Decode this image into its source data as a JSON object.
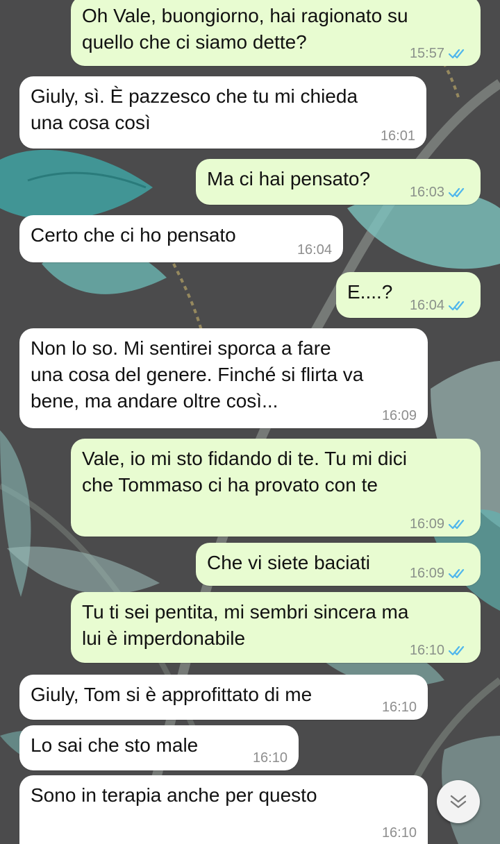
{
  "messages": [
    {
      "dir": "out",
      "text": "Oh Vale, buongiorno, hai ragionato su\nquello che ci siamo dette?",
      "time": "15:57",
      "read": true
    },
    {
      "dir": "in",
      "text": "Giuly, sì. È pazzesco che tu mi chieda\nuna cosa così",
      "time": "16:01"
    },
    {
      "dir": "out",
      "text": "Ma ci hai pensato?",
      "time": "16:03",
      "read": true
    },
    {
      "dir": "in",
      "text": "Certo che ci ho pensato",
      "time": "16:04"
    },
    {
      "dir": "out",
      "text": "E....?",
      "time": "16:04",
      "read": true
    },
    {
      "dir": "in",
      "text": "Non lo so. Mi sentirei sporca a fare\nuna cosa del genere. Finché si flirta va\nbene, ma andare oltre così...",
      "time": "16:09"
    },
    {
      "dir": "out",
      "text": "Vale, io mi sto fidando di te. Tu mi dici\nche Tommaso ci ha provato con te",
      "time": "16:09",
      "read": true
    },
    {
      "dir": "out",
      "text": "Che vi siete baciati",
      "time": "16:09",
      "read": true
    },
    {
      "dir": "out",
      "text": "Tu ti sei pentita, mi sembri sincera ma\nlui è imperdonabile",
      "time": "16:10",
      "read": true
    },
    {
      "dir": "in",
      "text": "Giuly, Tom si è approfittato di me",
      "time": "16:10"
    },
    {
      "dir": "in",
      "text": "Lo sai che sto male",
      "time": "16:10"
    },
    {
      "dir": "in",
      "text": "Sono in terapia anche per questo",
      "time": "16:10"
    }
  ],
  "scroll_button": {
    "icon": "double-chevron-down-icon"
  },
  "colors": {
    "outgoing_bubble": "#e8fcd1",
    "incoming_bubble": "#ffffff",
    "read_ticks": "#4fb6ec",
    "wallpaper_base": "#4b4b4c"
  }
}
